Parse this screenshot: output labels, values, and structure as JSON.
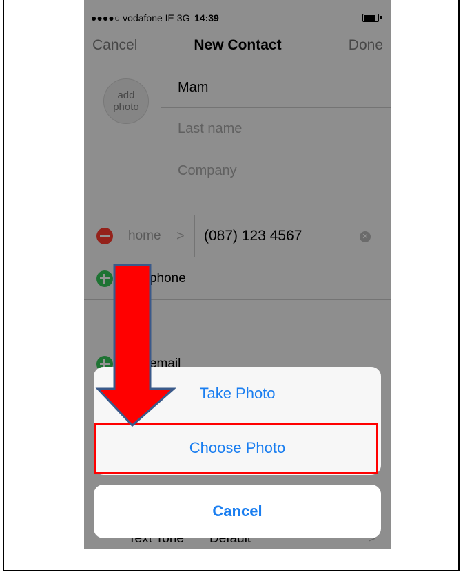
{
  "status_bar": {
    "carrier": "●●●●○ vodafone IE  3G",
    "time": "14:39"
  },
  "nav": {
    "cancel": "Cancel",
    "title": "New Contact",
    "done": "Done"
  },
  "avatar": {
    "line1": "add",
    "line2": "photo"
  },
  "fields": {
    "first_name": "Mam",
    "last_name_placeholder": "Last name",
    "company_placeholder": "Company"
  },
  "phone": {
    "label": "home",
    "chevron": ">",
    "number": "(087) 123 4567"
  },
  "rows": {
    "add_phone": "add phone",
    "add_email": "add email"
  },
  "text_tone": {
    "label": "Text Tone",
    "value": "Default",
    "chevron": ">"
  },
  "action_sheet": {
    "take_photo": "Take Photo",
    "choose_photo": "Choose Photo",
    "cancel": "Cancel"
  },
  "colors": {
    "ios_blue": "#1a7ef0",
    "annotation_red": "#ff0000",
    "delete_red": "#ff3b30",
    "add_green": "#34c759"
  }
}
